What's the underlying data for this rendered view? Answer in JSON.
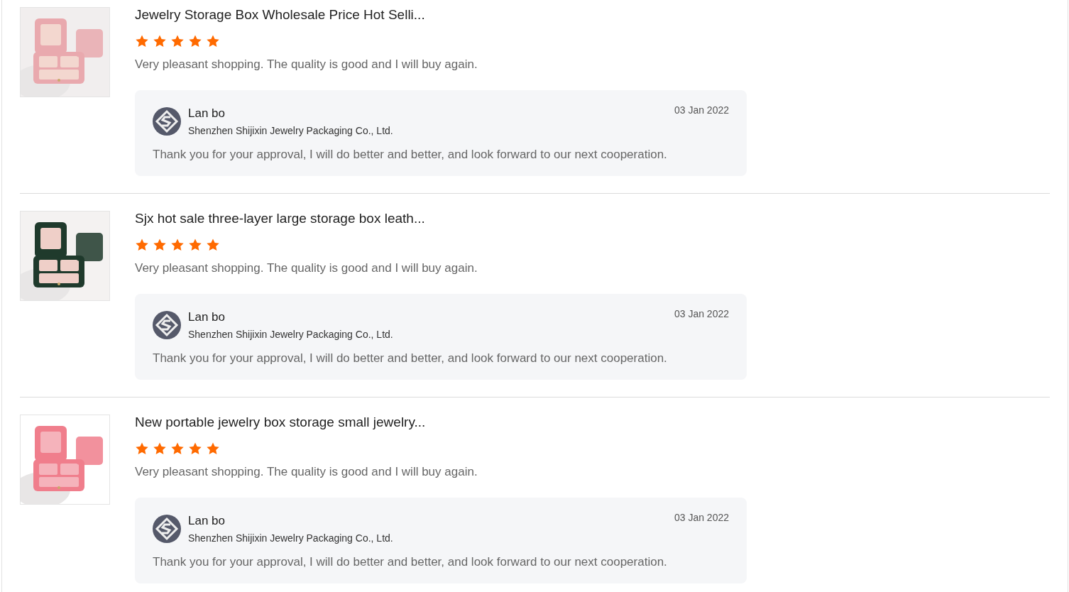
{
  "reviews": [
    {
      "product": {
        "kind": "picture",
        "title": "Jewelry Storage Box Wholesale Price Hot Selli..."
      },
      "stars": 5,
      "comment": "Very pleasant shopping. The quality is good and I will buy again.",
      "reply": {
        "name": "Lan bo",
        "company": "Shenzhen Shijixin Jewelry Packaging Co., Ltd.",
        "date": "03 Jan 2022",
        "text": "Thank you for your approval, I will do better and better, and look forward to our next cooperation."
      }
    },
    {
      "product": {
        "kind": "picture",
        "title": "Sjx hot sale three-layer large storage box leath..."
      },
      "stars": 5,
      "comment": "Very pleasant shopping. The quality is good and I will buy again.",
      "reply": {
        "name": "Lan bo",
        "company": "Shenzhen Shijixin Jewelry Packaging Co., Ltd.",
        "date": "03 Jan 2022",
        "text": "Thank you for your approval, I will do better and better, and look forward to our next cooperation."
      }
    },
    {
      "product": {
        "kind": "picture",
        "title": "New portable jewelry box storage small jewelry..."
      },
      "stars": 5,
      "comment": "Very pleasant shopping. The quality is good and I will buy again.",
      "reply": {
        "name": "Lan bo",
        "company": "Shenzhen Shijixin Jewelry Packaging Co., Ltd.",
        "date": "03 Jan 2022",
        "text": "Thank you for your approval, I will do better and better, and look forward to our next cooperation."
      }
    }
  ]
}
